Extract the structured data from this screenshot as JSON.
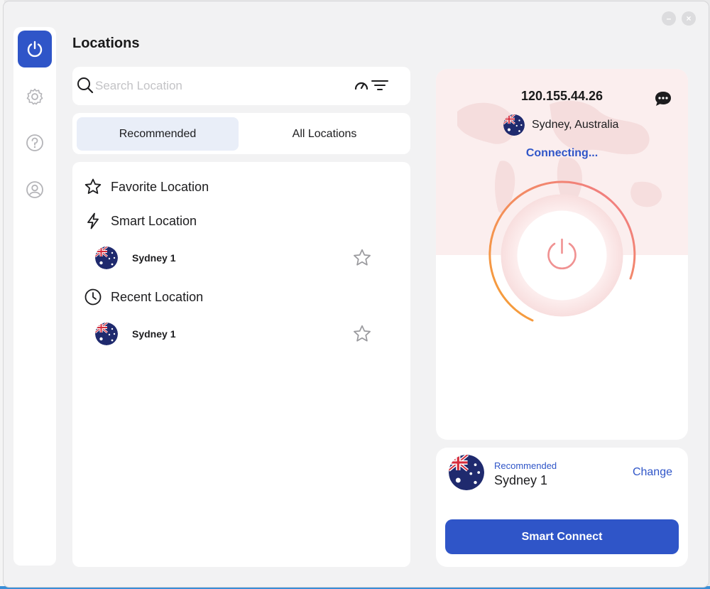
{
  "window": {
    "minimize_label": "–",
    "close_label": "×"
  },
  "sidebar": {
    "items": [
      {
        "name": "power",
        "icon": "power-icon",
        "active": true
      },
      {
        "name": "settings",
        "icon": "gear-icon",
        "active": false
      },
      {
        "name": "help",
        "icon": "question-circle-icon",
        "active": false
      },
      {
        "name": "account",
        "icon": "user-circle-icon",
        "active": false
      }
    ]
  },
  "left": {
    "title": "Locations",
    "search": {
      "placeholder": "Search Location",
      "value": ""
    },
    "tabs": [
      {
        "label": "Recommended",
        "active": true
      },
      {
        "label": "All Locations",
        "active": false
      }
    ],
    "sections": {
      "favorite": {
        "label": "Favorite Location",
        "icon": "star-outline-icon"
      },
      "smart": {
        "label": "Smart Location",
        "icon": "lightning-icon",
        "items": [
          {
            "name": "Sydney 1",
            "flag": "australia-flag"
          }
        ]
      },
      "recent": {
        "label": "Recent Location",
        "icon": "clock-icon",
        "items": [
          {
            "name": "Sydney 1",
            "flag": "australia-flag"
          }
        ]
      }
    }
  },
  "status": {
    "ip": "120.155.44.26",
    "location": "Sydney, Australia",
    "state": "Connecting...",
    "progress": 0.5
  },
  "connect": {
    "recommended_label": "Recommended",
    "server_name": "Sydney 1",
    "change_label": "Change",
    "button_label": "Smart Connect"
  },
  "colors": {
    "accent": "#2f55c8",
    "panel_tint": "#fbeeee",
    "arc_start": "#f6a033",
    "arc_end": "#f07a8a"
  }
}
